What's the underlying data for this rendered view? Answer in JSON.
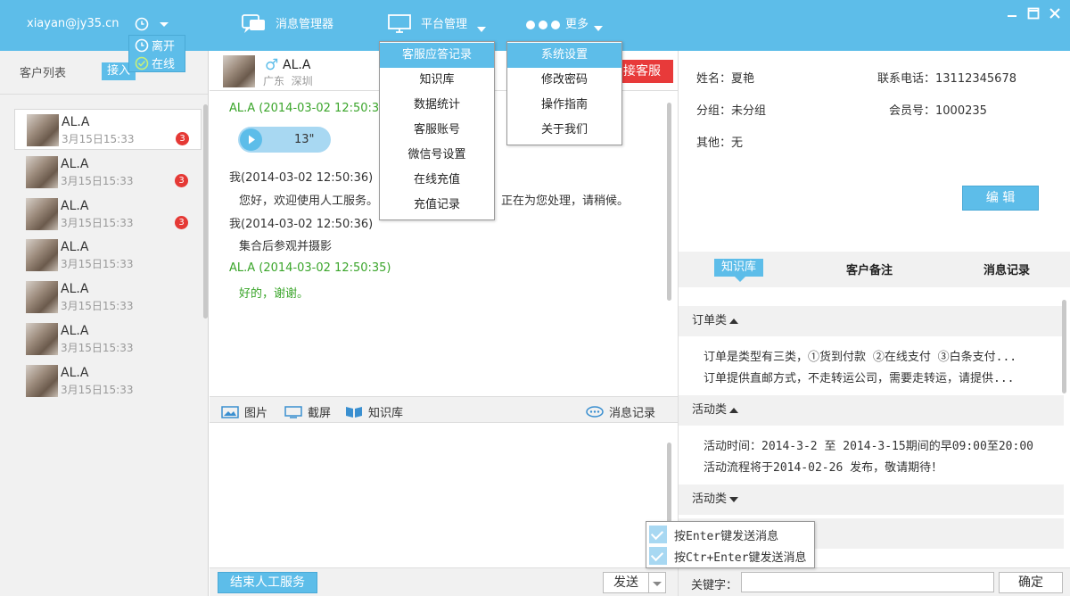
{
  "header": {
    "user_email": "xiayan@jy35.cn",
    "message_manager": "消息管理器",
    "platform_management": "平台管理",
    "more": "更多"
  },
  "status_menu": {
    "away": "离开",
    "online": "在线"
  },
  "left_panel": {
    "customer_list_label": "客户列表",
    "receive_button": "接入",
    "customers": [
      {
        "name": "AL.A",
        "time": "3月15日15:33",
        "badge": "3"
      },
      {
        "name": "AL.A",
        "time": "3月15日15:33",
        "badge": "3"
      },
      {
        "name": "AL.A",
        "time": "3月15日15:33",
        "badge": "3"
      },
      {
        "name": "AL.A",
        "time": "3月15日15:33",
        "badge": ""
      },
      {
        "name": "AL.A",
        "time": "3月15日15:33",
        "badge": ""
      },
      {
        "name": "AL.A",
        "time": "3月15日15:33",
        "badge": ""
      },
      {
        "name": "AL.A",
        "time": "3月15日15:33",
        "badge": ""
      }
    ]
  },
  "chat": {
    "contact_name": "AL.A",
    "gender_symbol": "♂",
    "location": "广东  深圳",
    "transfer_button": "接客服",
    "messages": {
      "m1_meta": "AL.A (2014-03-02 12:50:35)",
      "voice_duration": "13\"",
      "m2_meta": "我(2014-03-02 12:50:36)",
      "m2_text_a": "您好，欢迎使用人工服务。",
      "m2_text_b": "正在为您处理，请稍候。",
      "m3_meta": "我(2014-03-02 12:50:36)",
      "m3_text": "集合后参观并摄影",
      "m4_meta": "AL.A (2014-03-02 12:50:35)",
      "m4_text": "好的，谢谢。"
    },
    "toolbar": {
      "image": "图片",
      "screenshot": "截屏",
      "knowledge": "知识库",
      "history": "消息记录"
    },
    "end_service_button": "结束人工服务",
    "send_button": "发送"
  },
  "platform_menu": [
    "客服应答记录",
    "知识库",
    "数据统计",
    "客服账号",
    "微信号设置",
    "在线充值",
    "充值记录"
  ],
  "more_menu": [
    "系统设置",
    "修改密码",
    "操作指南",
    "关于我们"
  ],
  "send_options": [
    "按Enter键发送消息",
    "按Ctr+Enter键发送消息"
  ],
  "customer_info": {
    "name_label": "姓名：",
    "name": "夏艳",
    "phone_label": "联系电话：",
    "phone": "13112345678",
    "group_label": "分组：",
    "group": "未分组",
    "member_label": "会员号：",
    "member": "1000235",
    "other_label": "其他：",
    "other": "无",
    "edit_button": "编 辑"
  },
  "right_tabs": {
    "knowledge": "知识库",
    "notes": "客户备注",
    "history": "消息记录"
  },
  "knowledge": {
    "sec1_title": "订单类",
    "sec1_line1": "订单是类型有三类，①货到付款 ②在线支付  ③白条支付...",
    "sec1_line2": "订单提供直邮方式，不走转运公司，需要走转运，请提供...",
    "sec2_title": "活动类",
    "sec2_line1": "活动时间：2014-3-2 至 2014-3-15期间的早09:00至20:00",
    "sec2_line2": "活动流程将于2014-02-26 发布，敬请期待！",
    "sec3_title": "活动类",
    "keyword_label": "关键字：",
    "keyword_value": "",
    "confirm_button": "确定"
  },
  "colors": {
    "accent": "#5dbde9",
    "badge": "#e53935",
    "incoming_text": "#3aa52a"
  }
}
